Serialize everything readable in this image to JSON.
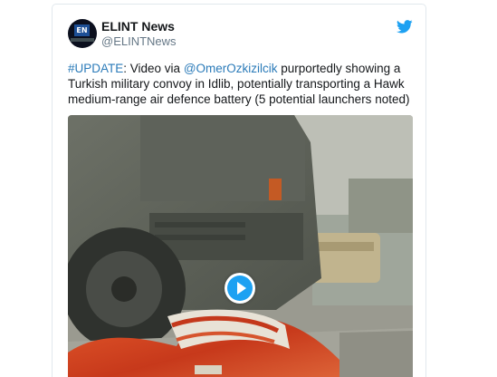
{
  "tweet": {
    "author": {
      "name": "ELINT News",
      "handle": "@ELINTNews",
      "avatar_text": "EN"
    },
    "text": {
      "hashtag": "#UPDATE",
      "part1": ": Video via ",
      "mention": "@OmerOzkizilcik",
      "part2": " purportedly showing a Turkish military convoy in Idlib, potentially transporting a Hawk medium-range air defence battery (5 potential launchers noted)"
    },
    "media": {
      "type": "video",
      "play_icon": "play-icon"
    }
  },
  "icons": {
    "platform": "twitter-bird-icon"
  },
  "colors": {
    "link": "#2b7bb9",
    "brand": "#1da1f2",
    "name": "#14171a",
    "handle": "#657786"
  }
}
